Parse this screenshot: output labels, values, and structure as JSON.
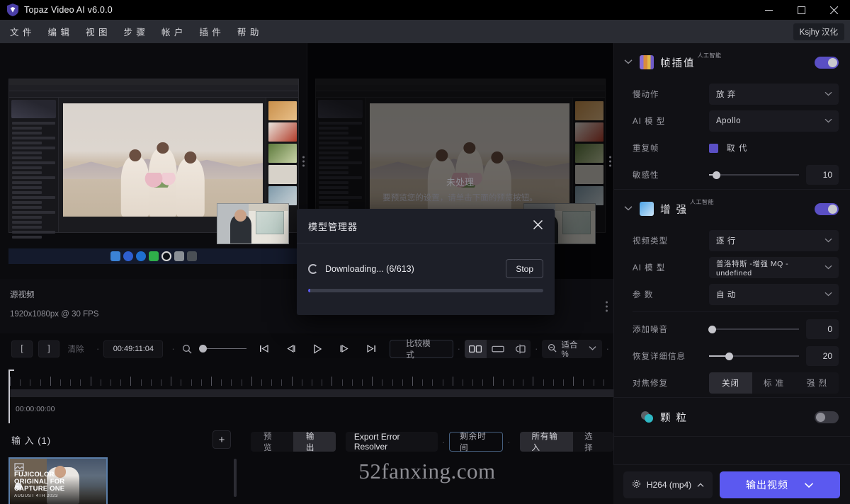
{
  "window": {
    "title": "Topaz Video AI  v6.0.0",
    "logo_icon": "topaz-shield-icon",
    "minimize_icon": "minimize-icon",
    "maximize_icon": "maximize-icon",
    "close_icon": "close-icon"
  },
  "menubar": {
    "items": [
      "文 件",
      "编 辑",
      "视 图",
      "步 骤",
      "帐 户",
      "插 件",
      "帮 助"
    ],
    "lang_badge": "Ksjhy 汉化"
  },
  "preview": {
    "left_label": "",
    "right_title": "未处理",
    "right_hint": "要预览您的设置，请单击下面的预览按钮。",
    "menu_icon": "vertical-dots-icon"
  },
  "source": {
    "label": "源视频",
    "details": "1920x1080px @ 30 FPS"
  },
  "transport": {
    "mark_in": "[",
    "mark_out": "]",
    "clear_label": "清除",
    "timecode": "00:49:11:04",
    "search_icon": "magnifier-icon",
    "go_start_icon": "skip-to-start-icon",
    "prev_frame_icon": "step-back-icon",
    "play_icon": "play-icon",
    "next_frame_icon": "step-forward-icon",
    "go_end_icon": "skip-to-end-icon",
    "compare_label": "比较模式",
    "view_modes": [
      {
        "name": "side-by-side-view-icon",
        "selected": true
      },
      {
        "name": "single-view-icon",
        "selected": false
      },
      {
        "name": "split-view-icon",
        "selected": false
      }
    ],
    "zoom_icon": "zoom-out-icon",
    "zoom_label": "适合 %",
    "zoom_chevron": "chevron-down-icon"
  },
  "timeline": {
    "start_time": "00:00:00:00"
  },
  "inputs": {
    "title": "输 入 (1)",
    "add_icon": "plus-icon",
    "card": {
      "overlay_line1": "FUJICOLOR",
      "overlay_line2": "ORIGINAL FOR",
      "overlay_line3": "CAPTURE ONE",
      "overlay_line4": "AUGUST 4TH 2023"
    }
  },
  "actions": {
    "preview_tabs": [
      {
        "label": "预 览",
        "selected": false
      },
      {
        "label": "输 出",
        "selected": true
      }
    ],
    "export_error_resolver": "Export Error Resolver",
    "remaining_time": "剩余时间",
    "input_scope": [
      {
        "label": "所有输入",
        "selected": true
      },
      {
        "label": "选 择",
        "selected": false
      }
    ],
    "watermark": "52fanxing.com"
  },
  "panel": {
    "sections": [
      {
        "id": "frame-interpolation",
        "title": "帧插值",
        "superscript": "人工智能",
        "icon": "frame-interpolation-icon",
        "enabled": true,
        "chevron": "chevron-down-icon",
        "rows": [
          {
            "type": "select",
            "label": "慢动作",
            "value": "放 弃"
          },
          {
            "type": "select",
            "label": "AI 模 型",
            "value": "Apollo"
          },
          {
            "type": "checkbox",
            "label": "重复帧",
            "value": "取 代",
            "checked": true
          },
          {
            "type": "slider",
            "label": "敏感性",
            "value": "10",
            "pct": 8
          }
        ]
      },
      {
        "id": "enhancement",
        "title": "增 强",
        "superscript": "人工智能",
        "icon": "enhancement-icon",
        "enabled": true,
        "chevron": "chevron-down-icon",
        "rows": [
          {
            "type": "select",
            "label": "视频类型",
            "value": "逐 行"
          },
          {
            "type": "select",
            "label": "AI 模 型",
            "value": "普洛特斯 -增强 MQ - undefined"
          },
          {
            "type": "select",
            "label": "参 数",
            "value": "自 动"
          },
          {
            "type": "slider",
            "label": "添加噪音",
            "value": "0",
            "pct": 0
          },
          {
            "type": "slider",
            "label": "恢复详细信息",
            "value": "20",
            "pct": 22
          },
          {
            "type": "segment",
            "label": "对焦修复",
            "options": [
              {
                "label": "关闭",
                "selected": true
              },
              {
                "label": "标 准",
                "selected": false
              },
              {
                "label": "强 烈",
                "selected": false
              }
            ]
          }
        ]
      },
      {
        "id": "grain",
        "title": "颗 粒",
        "superscript": "",
        "icon": "grain-icon",
        "enabled": false,
        "chevron": "",
        "rows": []
      }
    ]
  },
  "export": {
    "codec_icon": "gear-icon",
    "codec_label": "H264 (mp4)",
    "codec_chevron": "chevron-up-icon",
    "export_label": "输出视频",
    "export_chevron": "chevron-down-icon"
  },
  "modal": {
    "title": "模型管理器",
    "close_icon": "close-icon",
    "spinner_icon": "loading-spinner-icon",
    "status": "Downloading... (6/613)",
    "stop_label": "Stop",
    "progress_pct": 1
  },
  "colors": {
    "accent": "#5b59f0",
    "toggle_on": "#5a4fc4",
    "panel_bg": "#111115",
    "modal_bg": "#1d1f28",
    "titlebar_bg": "#000000",
    "menubar_bg": "#2a2c33"
  }
}
